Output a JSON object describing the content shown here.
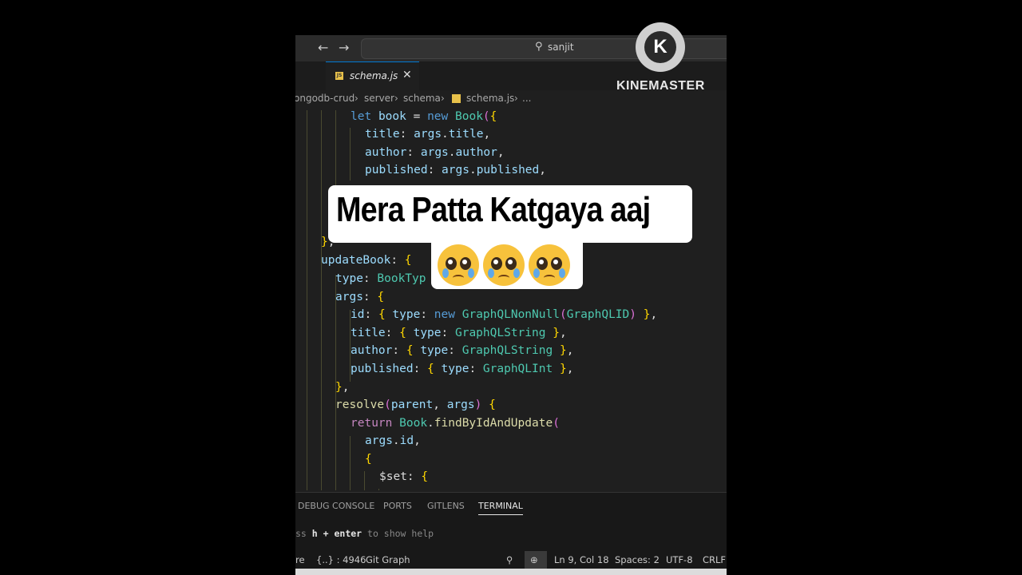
{
  "titlebar": {
    "back": "←",
    "forward": "→",
    "search": "sanjit"
  },
  "tab": {
    "icon_text": "JS",
    "label": "schema.js",
    "close": "✕"
  },
  "breadcrumbs": [
    "ongodb-crud",
    "server",
    "schema",
    "schema.js",
    "..."
  ],
  "breadcrumb_sep": "›",
  "panel": {
    "tabs": [
      "DEBUG CONSOLE",
      "PORTS",
      "GITLENS",
      "TERMINAL"
    ],
    "terminal_pre": "ss ",
    "terminal_bold": "h + enter",
    "terminal_post": " to show help"
  },
  "statusbar": {
    "left": "re",
    "braces": "{..} : 4946",
    "git": "Git Graph",
    "ln_col": "Ln 9, Col 18",
    "spaces": "Spaces: 2",
    "encoding": "UTF-8",
    "eol": "CRLF"
  },
  "watermark": {
    "letter": "K",
    "text": "KINEMASTER"
  },
  "caption": {
    "line1": "Mera Patta Katgaya aaj",
    "emoji": [
      "🥹",
      "🥹",
      "🥹"
    ]
  },
  "code_lines": [
    "let book = new Book({",
    "title: args.title,",
    "author: args.author,",
    "published: args.published,",
    "},",
    "updateBook: {",
    "type: BookTyp",
    "args: {",
    "id: { type: new GraphQLNonNull(GraphQLID) },",
    "title: { type: GraphQLString },",
    "author: { type: GraphQLString },",
    "published: { type: GraphQLInt },",
    "},",
    "resolve(parent, args) {",
    "return Book.findByIdAndUpdate(",
    "args.id,",
    "{",
    "$set: {"
  ],
  "colors": {
    "editor_bg": "#1f1f1f",
    "accent": "#0078d4",
    "caption_bg": "#ffffff"
  }
}
